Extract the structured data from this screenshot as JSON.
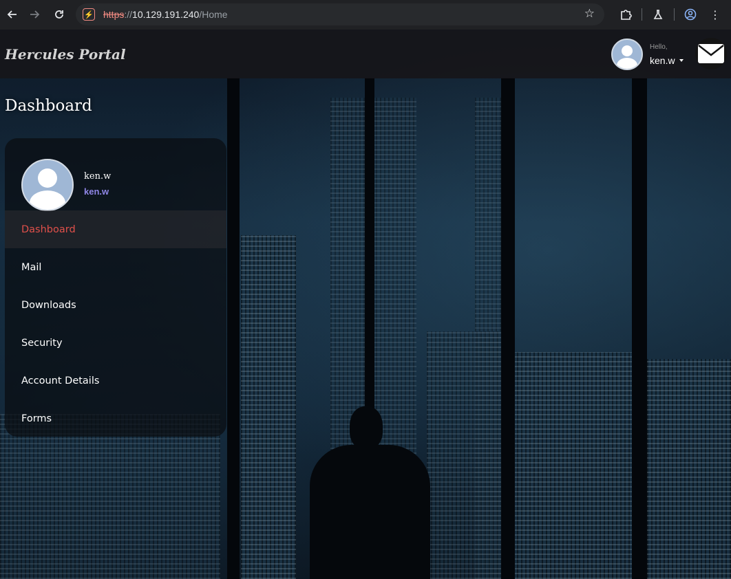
{
  "browser": {
    "url_scheme": "https",
    "url_sep": "://",
    "url_host": "10.129.191.240",
    "url_path": "/Home"
  },
  "header": {
    "brand": "Hercules Portal",
    "greeting": "Hello,",
    "username": "ken.w"
  },
  "page": {
    "title": "Dashboard"
  },
  "sidebar": {
    "profile_name": "ken.w",
    "profile_handle": "ken.w",
    "items": [
      {
        "label": "Dashboard",
        "active": true
      },
      {
        "label": "Mail",
        "active": false
      },
      {
        "label": "Downloads",
        "active": false
      },
      {
        "label": "Security",
        "active": false
      },
      {
        "label": "Account Details",
        "active": false
      },
      {
        "label": "Forms",
        "active": false
      }
    ]
  },
  "colors": {
    "active_item": "#e0504a",
    "handle": "#8f86e6",
    "url_warning": "#f28b82"
  }
}
